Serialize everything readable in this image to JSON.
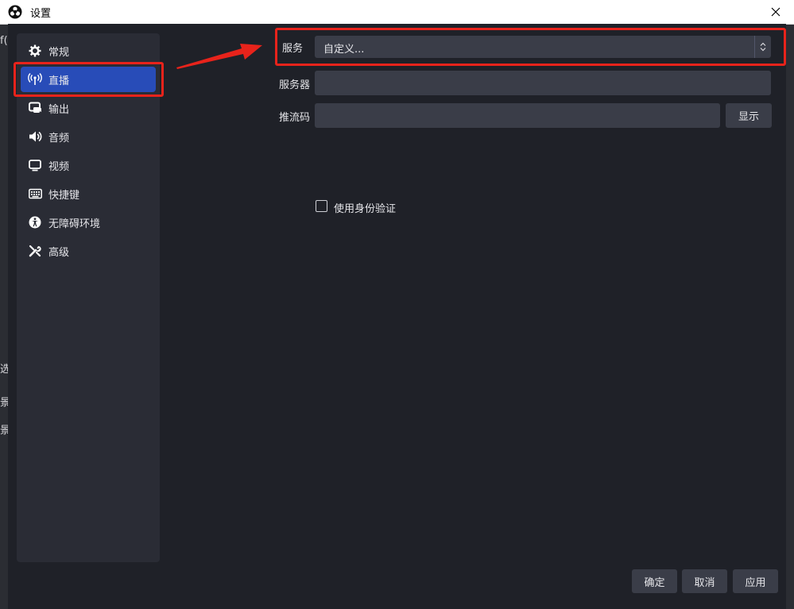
{
  "window": {
    "title": "设置"
  },
  "background": {
    "left_fragment": "f(",
    "left_text_a": "选",
    "left_text_b": "景",
    "left_text_c": "景"
  },
  "sidebar": {
    "items": [
      {
        "label": "常规",
        "icon": "gear-icon"
      },
      {
        "label": "直播",
        "icon": "antenna-icon",
        "active": true
      },
      {
        "label": "输出",
        "icon": "output-icon"
      },
      {
        "label": "音频",
        "icon": "speaker-icon"
      },
      {
        "label": "视频",
        "icon": "monitor-icon"
      },
      {
        "label": "快捷键",
        "icon": "keyboard-icon"
      },
      {
        "label": "无障碍环境",
        "icon": "accessibility-icon"
      },
      {
        "label": "高级",
        "icon": "tools-icon"
      }
    ]
  },
  "stream": {
    "service_label": "服务",
    "service_value": "自定义...",
    "server_label": "服务器",
    "server_value": "",
    "key_label": "推流码",
    "key_value": "",
    "show_button": "显示",
    "auth_label": "使用身份验证"
  },
  "footer": {
    "ok": "确定",
    "cancel": "取消",
    "apply": "应用"
  },
  "colors": {
    "accent": "#284cb8",
    "annotation": "#e8231b"
  }
}
